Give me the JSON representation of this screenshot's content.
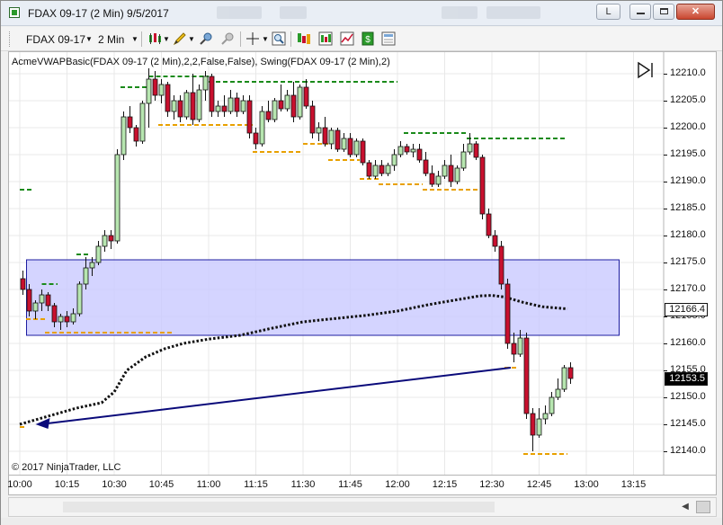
{
  "window": {
    "title": "FDAX 09-17 (2 Min)  9/5/2017",
    "lock_label": "L",
    "minimize_label": "▭",
    "maximize_label": "▭",
    "close_label": "✕"
  },
  "toolbar": {
    "instrument": "FDAX 09-17",
    "interval": "2 Min",
    "icons": [
      "bar-type-icon",
      "drawing-tool-icon",
      "crosshair-gear-icon",
      "global-crosshair-icon",
      "crosshair-icon",
      "zoom-icon",
      "indicators-icon",
      "strategies-icon",
      "chart-properties-icon",
      "data-box-icon",
      "order-panel-icon"
    ]
  },
  "chart": {
    "indicator_label": "AcmeVWAPBasic(FDAX 09-17 (2 Min),2,2,False,False), Swing(FDAX 09-17 (2 Min),2)",
    "copyright": "© 2017 NinjaTrader, LLC",
    "y_ticks": [
      "12210.0",
      "12205.0",
      "12200.0",
      "12195.0",
      "12190.0",
      "12185.0",
      "12180.0",
      "12175.0",
      "12170.0",
      "12165.0",
      "12160.0",
      "12155.0",
      "12150.0",
      "12145.0",
      "12140.0"
    ],
    "x_ticks": [
      "10:00",
      "10:15",
      "10:30",
      "10:45",
      "11:00",
      "11:15",
      "11:30",
      "11:45",
      "12:00",
      "12:15",
      "12:30",
      "12:45",
      "13:00",
      "13:15"
    ],
    "price_tag_vwap": "12166.4",
    "price_tag_last": "12153.5",
    "colors": {
      "up": "#b7e6b0",
      "down": "#c8102e",
      "outline": "#111111",
      "swing_high": "#1a8a1a",
      "swing_low": "#e8a000",
      "vwap": "#111111",
      "zone_fill": "#c9c9ff",
      "zone_border": "#1c1ca0",
      "arrow": "#0a0a7a"
    }
  },
  "chart_data": {
    "type": "candlestick",
    "y_range": [
      12137.5,
      12213.5
    ],
    "x_range": [
      "10:00",
      "13:20"
    ],
    "bars": [
      [
        "10:00",
        12172,
        12173.5,
        12169,
        12170
      ],
      [
        "10:02",
        12170,
        12171,
        12165,
        12166
      ],
      [
        "10:04",
        12166,
        12168,
        12164.5,
        12167.5
      ],
      [
        "10:06",
        12167.5,
        12170,
        12166,
        12169
      ],
      [
        "10:08",
        12169,
        12169.5,
        12166,
        12167
      ],
      [
        "10:10",
        12167,
        12167.5,
        12163,
        12164
      ],
      [
        "10:12",
        12164,
        12165.5,
        12162.5,
        12165
      ],
      [
        "10:14",
        12165,
        12166,
        12163,
        12164
      ],
      [
        "10:16",
        12164,
        12166.5,
        12163.5,
        12165.5
      ],
      [
        "10:18",
        12165.5,
        12171.5,
        12165,
        12171
      ],
      [
        "10:20",
        12171,
        12176,
        12170,
        12174
      ],
      [
        "10:22",
        12174,
        12176,
        12172.5,
        12175
      ],
      [
        "10:24",
        12175,
        12179,
        12174.5,
        12178
      ],
      [
        "10:26",
        12178,
        12181,
        12177,
        12180
      ],
      [
        "10:28",
        12180,
        12181,
        12177.5,
        12179
      ],
      [
        "10:30",
        12179,
        12196,
        12178.5,
        12195
      ],
      [
        "10:32",
        12195,
        12203,
        12194,
        12202
      ],
      [
        "10:34",
        12202,
        12204,
        12199,
        12200
      ],
      [
        "10:36",
        12200,
        12200.5,
        12196.5,
        12197.5
      ],
      [
        "10:38",
        12197.5,
        12205,
        12197,
        12204.5
      ],
      [
        "10:40",
        12204.5,
        12211,
        12200,
        12209
      ],
      [
        "10:42",
        12209,
        12210.5,
        12205,
        12206
      ],
      [
        "10:44",
        12206,
        12209,
        12204.5,
        12208
      ],
      [
        "10:46",
        12208,
        12208.5,
        12202,
        12203
      ],
      [
        "10:48",
        12203,
        12206,
        12201.5,
        12205
      ],
      [
        "10:50",
        12205,
        12206,
        12201,
        12202
      ],
      [
        "10:52",
        12202,
        12207,
        12201.5,
        12206.5
      ],
      [
        "10:54",
        12206.5,
        12210,
        12200.5,
        12201.5
      ],
      [
        "10:56",
        12201.5,
        12208,
        12201,
        12207
      ],
      [
        "10:58",
        12207,
        12210.5,
        12205,
        12209.5
      ],
      [
        "11:00",
        12209.5,
        12210,
        12202,
        12203
      ],
      [
        "11:02",
        12203,
        12205,
        12202,
        12204
      ],
      [
        "11:04",
        12204,
        12206,
        12202,
        12203
      ],
      [
        "11:06",
        12203,
        12207,
        12202.5,
        12205.5
      ],
      [
        "11:08",
        12205.5,
        12206.5,
        12202,
        12203
      ],
      [
        "11:10",
        12203,
        12206,
        12202.5,
        12205
      ],
      [
        "11:12",
        12205,
        12206,
        12198,
        12199
      ],
      [
        "11:14",
        12199,
        12200,
        12196,
        12197
      ],
      [
        "11:16",
        12197,
        12204,
        12196.5,
        12203
      ],
      [
        "11:18",
        12203,
        12205,
        12201,
        12201.5
      ],
      [
        "11:20",
        12201.5,
        12205.5,
        12201,
        12205
      ],
      [
        "11:22",
        12205,
        12208,
        12203,
        12203.5
      ],
      [
        "11:24",
        12203.5,
        12207,
        12203,
        12206
      ],
      [
        "11:26",
        12206,
        12208.5,
        12201,
        12202
      ],
      [
        "11:28",
        12202,
        12208,
        12201.5,
        12207.5
      ],
      [
        "11:30",
        12207.5,
        12209,
        12203.5,
        12204
      ],
      [
        "11:32",
        12204,
        12205,
        12198,
        12199
      ],
      [
        "11:34",
        12199,
        12201,
        12197.5,
        12200
      ],
      [
        "11:36",
        12200,
        12202,
        12196.5,
        12197
      ],
      [
        "11:38",
        12197,
        12200,
        12196,
        12199.5
      ],
      [
        "11:40",
        12199.5,
        12200,
        12195.5,
        12196
      ],
      [
        "11:42",
        12196,
        12199,
        12195.5,
        12198
      ],
      [
        "11:44",
        12198,
        12199,
        12194.5,
        12195
      ],
      [
        "11:46",
        12195,
        12198,
        12194.5,
        12197.5
      ],
      [
        "11:48",
        12197.5,
        12198,
        12193,
        12193.5
      ],
      [
        "11:50",
        12193.5,
        12194,
        12190.5,
        12191
      ],
      [
        "11:52",
        12191,
        12194,
        12190.5,
        12193
      ],
      [
        "11:54",
        12193,
        12194,
        12191,
        12191.5
      ],
      [
        "11:56",
        12191.5,
        12193.5,
        12191,
        12193
      ],
      [
        "11:58",
        12193,
        12196,
        12192,
        12195
      ],
      [
        "12:00",
        12195,
        12197.5,
        12194.5,
        12196.5
      ],
      [
        "12:02",
        12196.5,
        12197,
        12195,
        12195.5
      ],
      [
        "12:04",
        12195.5,
        12197,
        12194.5,
        12196
      ],
      [
        "12:06",
        12196,
        12197,
        12193.5,
        12194
      ],
      [
        "12:08",
        12194,
        12195.5,
        12191,
        12191.5
      ],
      [
        "12:10",
        12191.5,
        12193,
        12189,
        12189.5
      ],
      [
        "12:12",
        12189.5,
        12192,
        12189,
        12191
      ],
      [
        "12:14",
        12191,
        12194,
        12190.5,
        12193
      ],
      [
        "12:16",
        12193,
        12195,
        12189,
        12190
      ],
      [
        "12:18",
        12190,
        12193,
        12189.5,
        12192.5
      ],
      [
        "12:20",
        12192.5,
        12197,
        12192,
        12195.5
      ],
      [
        "12:22",
        12195.5,
        12199,
        12195,
        12197
      ],
      [
        "12:24",
        12197,
        12197.5,
        12194,
        12194.5
      ],
      [
        "12:26",
        12194.5,
        12195,
        12183,
        12184
      ],
      [
        "12:28",
        12184,
        12185,
        12179.5,
        12180
      ],
      [
        "12:30",
        12180,
        12181,
        12177,
        12178
      ],
      [
        "12:32",
        12178,
        12179,
        12170,
        12171
      ],
      [
        "12:34",
        12171,
        12172,
        12159,
        12160
      ],
      [
        "12:36",
        12160,
        12162,
        12156.5,
        12158
      ],
      [
        "12:38",
        12158,
        12162.5,
        12157.5,
        12161
      ],
      [
        "12:40",
        12161,
        12162,
        12146,
        12147
      ],
      [
        "12:42",
        12147,
        12148,
        12140,
        12143
      ],
      [
        "12:44",
        12143,
        12148,
        12142.5,
        12146
      ],
      [
        "12:46",
        12146,
        12148.5,
        12145,
        12147
      ],
      [
        "12:48",
        12147,
        12151,
        12146.5,
        12150
      ],
      [
        "12:50",
        12150,
        12153.5,
        12149.5,
        12151.5
      ],
      [
        "12:52",
        12151.5,
        12156,
        12151,
        12155.5
      ],
      [
        "12:54",
        12155.5,
        12156.5,
        12152.5,
        12153.5
      ]
    ],
    "swing_high_segments": [
      [
        12188.5,
        "10:00",
        "10:04"
      ],
      [
        12171,
        "10:07",
        "10:12"
      ],
      [
        12176.5,
        "10:18",
        "10:22"
      ],
      [
        12207.5,
        "10:32",
        "10:41"
      ],
      [
        12209.5,
        "10:41",
        "11:00"
      ],
      [
        12208.5,
        "11:00",
        "11:30"
      ],
      [
        12208.5,
        "11:30",
        "12:00"
      ],
      [
        12199,
        "12:02",
        "12:22"
      ],
      [
        12198,
        "12:22",
        "12:54"
      ]
    ],
    "swing_low_segments": [
      [
        12144.5,
        "10:00",
        "10:02"
      ],
      [
        12164.5,
        "10:02",
        "10:08"
      ],
      [
        12162,
        "10:08",
        "10:49"
      ],
      [
        12200.5,
        "10:44",
        "11:14"
      ],
      [
        12195.5,
        "11:14",
        "11:30"
      ],
      [
        12197,
        "11:30",
        "11:38"
      ],
      [
        12194,
        "11:38",
        "11:48"
      ],
      [
        12190.5,
        "11:48",
        "11:54"
      ],
      [
        12189.5,
        "11:54",
        "12:08"
      ],
      [
        12188.5,
        "12:08",
        "12:26"
      ],
      [
        12155.5,
        "12:34",
        "12:38"
      ],
      [
        12139.5,
        "12:40",
        "12:54"
      ]
    ],
    "vwap": [
      [
        "10:00",
        12145
      ],
      [
        "10:06",
        12146
      ],
      [
        "10:12",
        12147
      ],
      [
        "10:18",
        12148
      ],
      [
        "10:26",
        12149
      ],
      [
        "10:30",
        12151
      ],
      [
        "10:34",
        12155
      ],
      [
        "10:40",
        12157.5
      ],
      [
        "10:46",
        12159
      ],
      [
        "10:52",
        12160
      ],
      [
        "11:00",
        12160.8
      ],
      [
        "11:10",
        12161.5
      ],
      [
        "11:20",
        12162.8
      ],
      [
        "11:30",
        12164
      ],
      [
        "11:40",
        12164.6
      ],
      [
        "11:50",
        12165.2
      ],
      [
        "12:00",
        12166
      ],
      [
        "12:10",
        12167.2
      ],
      [
        "12:18",
        12168
      ],
      [
        "12:26",
        12168.8
      ],
      [
        "12:30",
        12168.9
      ],
      [
        "12:34",
        12168.6
      ],
      [
        "12:40",
        12167.6
      ],
      [
        "12:46",
        12166.8
      ],
      [
        "12:54",
        12166.4
      ]
    ],
    "zone": {
      "start": "10:02",
      "end": "13:20",
      "high": 12175.5,
      "low": 12161.5
    },
    "arrow": {
      "from": [
        "12:36",
        12155.5
      ],
      "to": [
        "10:05",
        12145
      ]
    }
  }
}
